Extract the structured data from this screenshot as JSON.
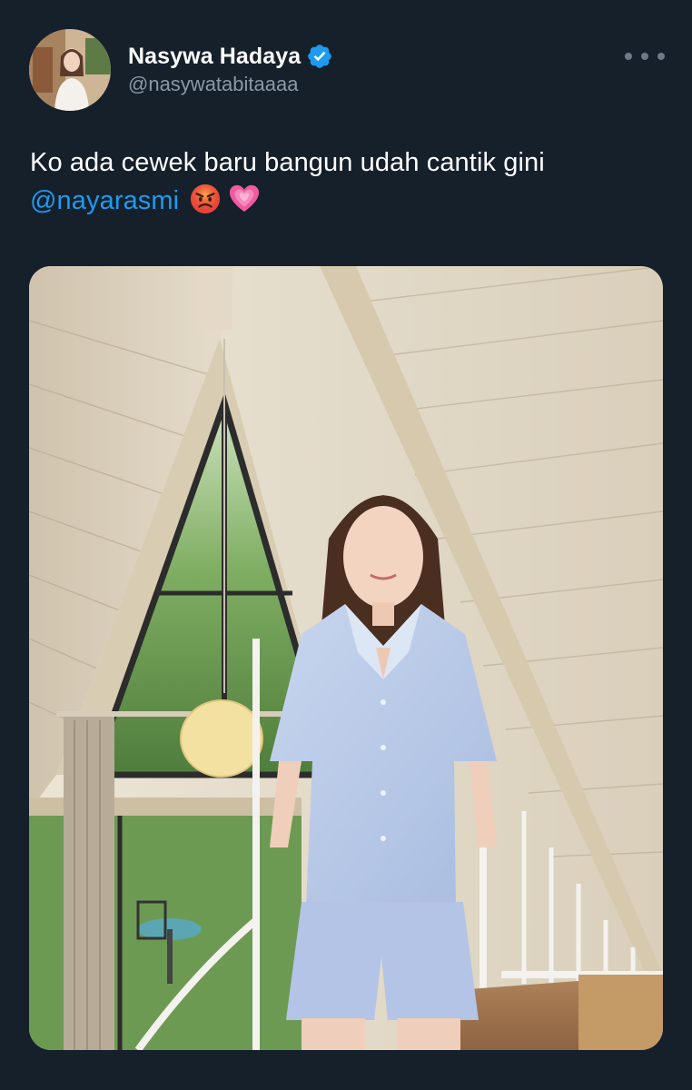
{
  "author": {
    "display_name": "Nasywa Hadaya",
    "handle": "@nasywatabitaaaa",
    "verified": true,
    "avatar_icon": "profile-photo"
  },
  "tweet": {
    "text_before_mention": "Ko ada cewek baru bangun udah cantik gini",
    "mention": "@nayarasmi",
    "emojis": [
      "angry-face-emoji",
      "growing-heart-emoji"
    ]
  },
  "menu": {
    "icon": "more-options-icon"
  },
  "media": {
    "type": "photo",
    "icon": "tweet-photo"
  },
  "colors": {
    "background": "#15202b",
    "text_primary": "#ffffff",
    "text_secondary": "#8b98a5",
    "link": "#1d9bf0",
    "verified_badge": "#1d9bf0"
  }
}
